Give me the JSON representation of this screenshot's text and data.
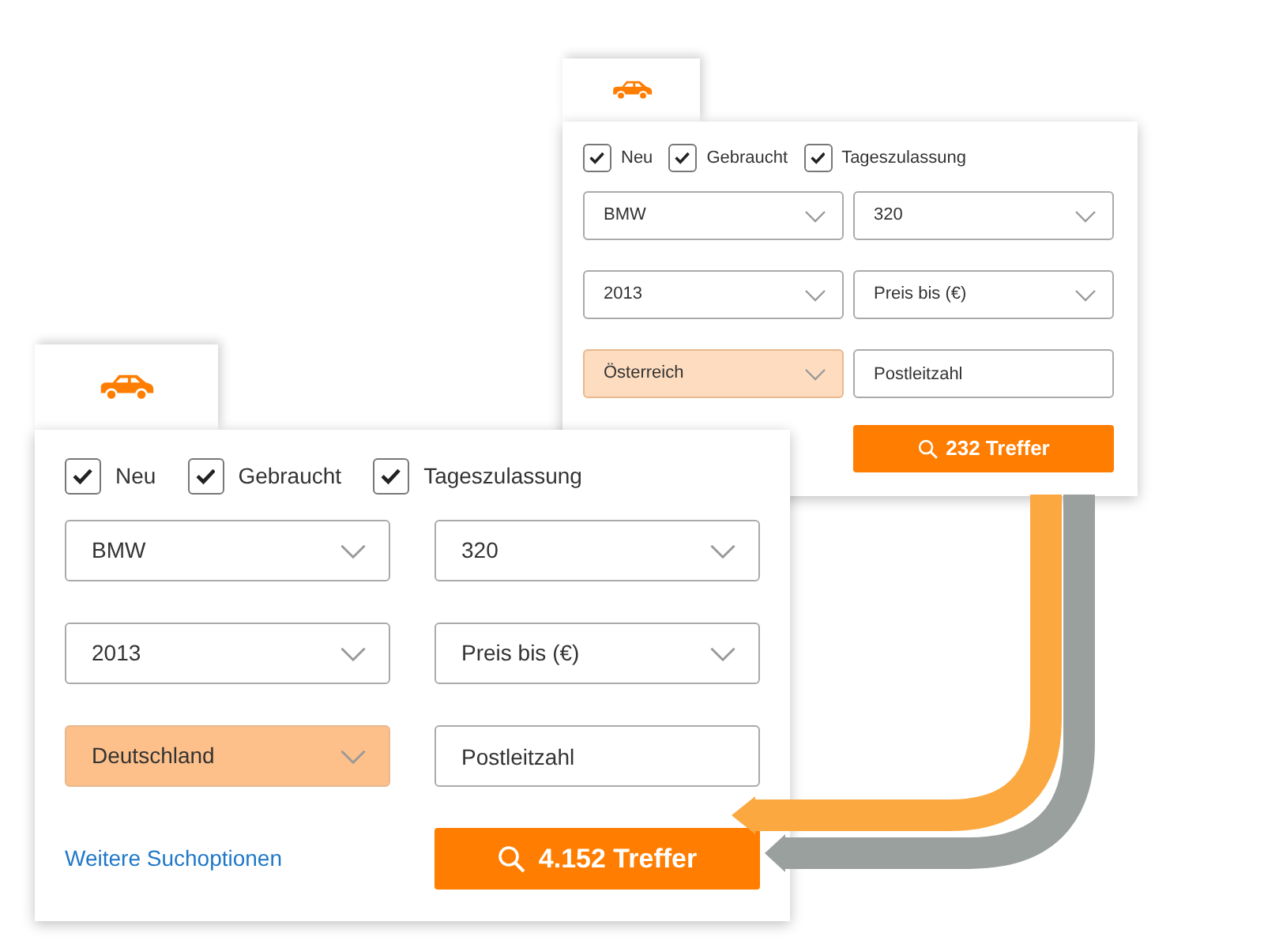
{
  "widgets": [
    {
      "tab": {
        "selected": true
      },
      "checkboxes": [
        {
          "label": "Neu",
          "checked": true
        },
        {
          "label": "Gebraucht",
          "checked": true
        },
        {
          "label": "Tageszulassung",
          "checked": true
        }
      ],
      "fields": [
        {
          "kind": "select",
          "value": "BMW"
        },
        {
          "kind": "select",
          "value": "320"
        },
        {
          "kind": "select",
          "value": "2013"
        },
        {
          "kind": "select",
          "value": "Preis bis (€)"
        },
        {
          "kind": "select",
          "value": "Österreich",
          "color": "#fddcbf"
        },
        {
          "kind": "input",
          "placeholder": "Postleitzahl"
        }
      ],
      "button": "232 Treffer"
    },
    {
      "tab": {
        "selected": true
      },
      "checkboxes": [
        {
          "label": "Neu",
          "checked": true
        },
        {
          "label": "Gebraucht",
          "checked": true
        },
        {
          "label": "Tageszulassung",
          "checked": true
        }
      ],
      "fields": [
        {
          "kind": "select",
          "value": "BMW"
        },
        {
          "kind": "select",
          "value": "320"
        },
        {
          "kind": "select",
          "value": "2013"
        },
        {
          "kind": "select",
          "value": "Preis bis (€)"
        },
        {
          "kind": "select",
          "value": "Deutschland",
          "color": "#fdc08a"
        },
        {
          "kind": "input",
          "placeholder": "Postleitzahl"
        }
      ],
      "link": "Weitere Suchoptionen",
      "button": "4.152 Treffer"
    }
  ]
}
